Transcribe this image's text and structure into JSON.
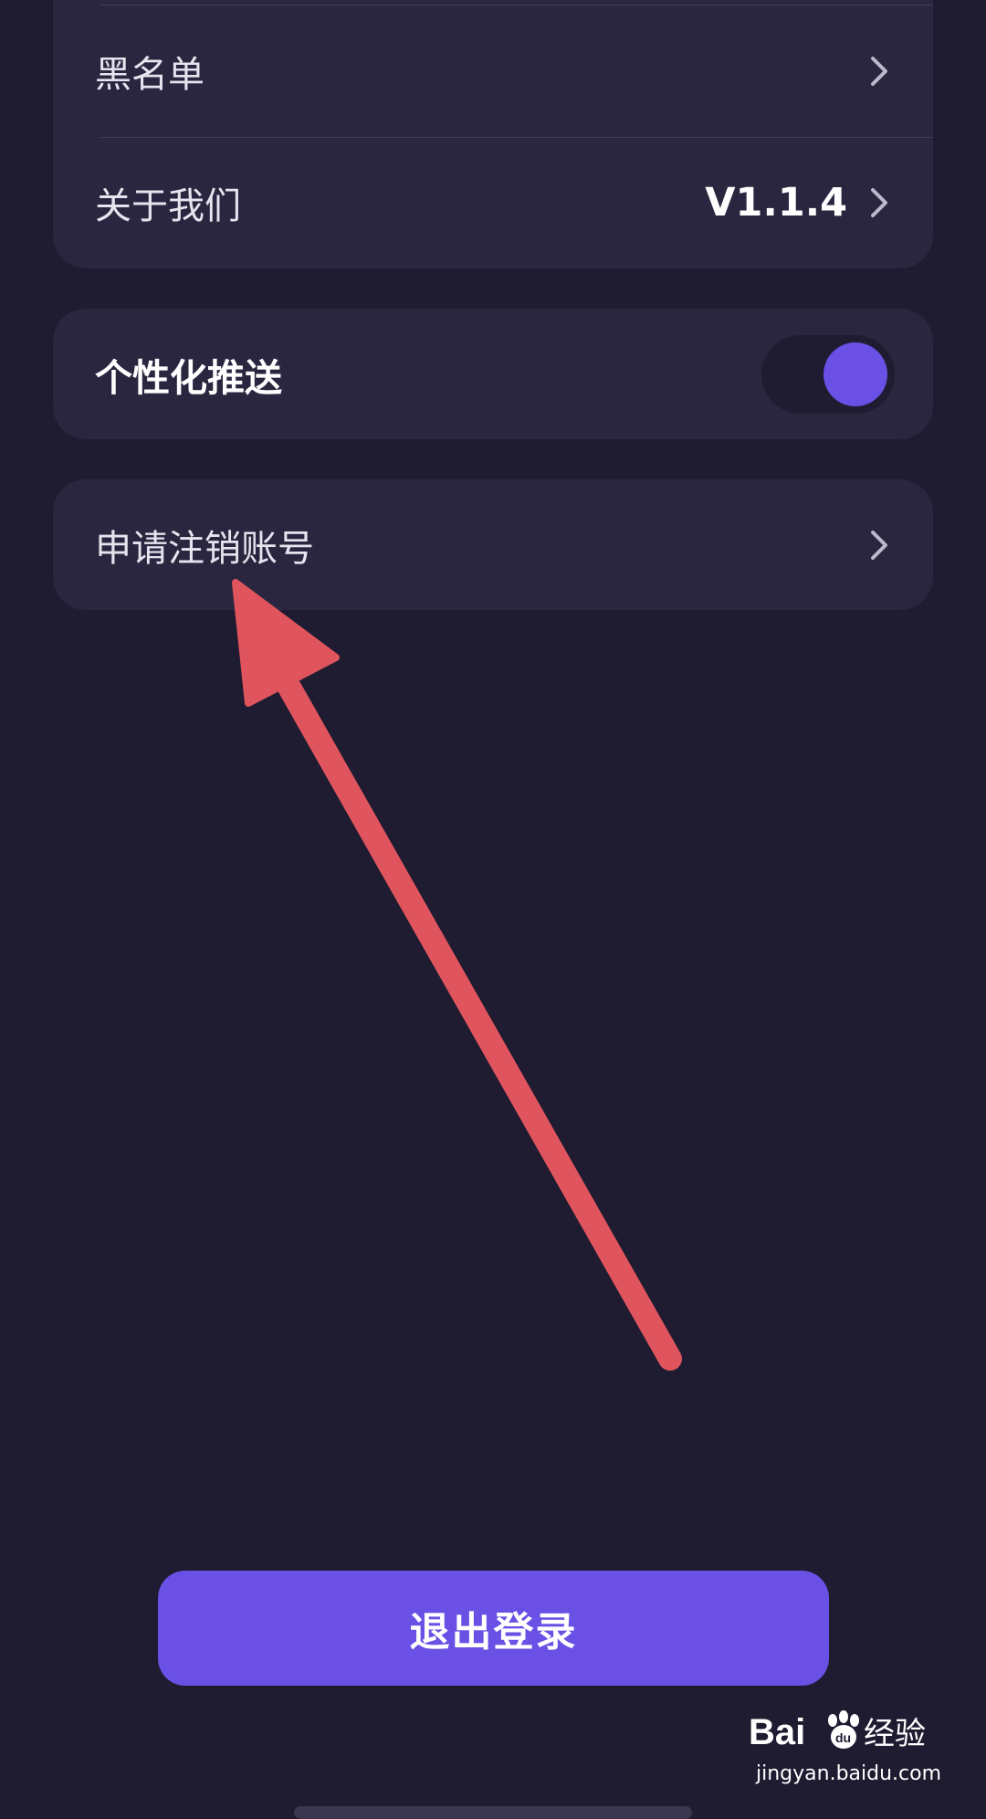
{
  "settings": {
    "blacklist_label": "黑名单",
    "about_label": "关于我们",
    "about_version": "V1.1.4",
    "push_label": "个性化推送",
    "push_enabled": true,
    "cancel_account_label": "申请注销账号"
  },
  "logout": {
    "label": "退出登录"
  },
  "watermark": {
    "logo_text": "Bai 经验",
    "url": "jingyan.baidu.com"
  },
  "colors": {
    "background": "#1f1b31",
    "card": "#2a263f",
    "accent": "#6a50e4",
    "annotation_arrow": "#e0555d"
  },
  "icons": {
    "chevron": "chevron-right-icon",
    "annotation": "arrow-annotation-icon",
    "toggle": "toggle-switch"
  }
}
